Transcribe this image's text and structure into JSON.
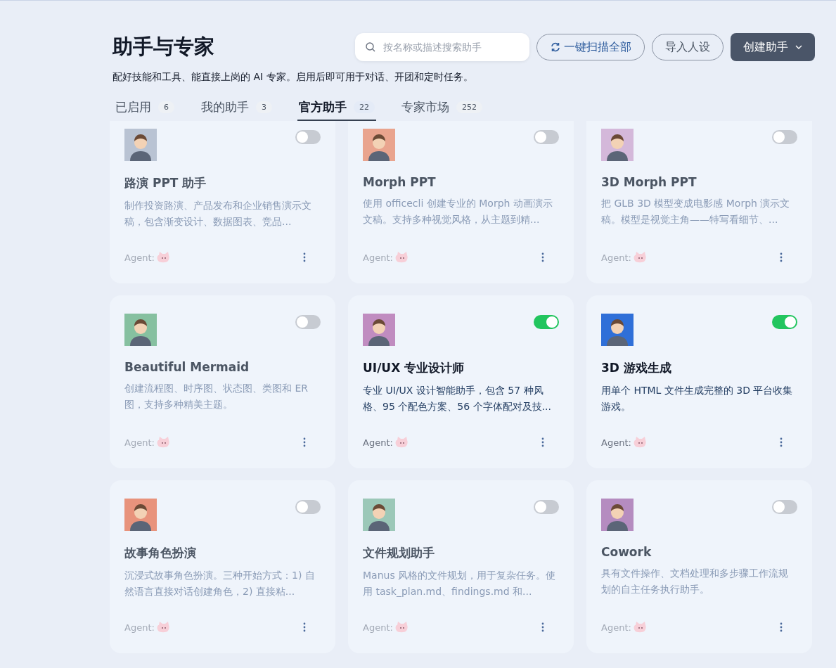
{
  "header": {
    "title": "助手与专家",
    "subtitle": "配好技能和工具、能直接上岗的 AI 专家。启用后即可用于对话、开团和定时任务。",
    "search": {
      "placeholder": "按名称或描述搜索助手"
    },
    "buttons": [
      {
        "label": "一键扫描全部",
        "kind": "scan"
      },
      {
        "label": "导入人设",
        "kind": "outline"
      },
      {
        "label": "创建助手",
        "kind": "primary"
      }
    ]
  },
  "tabs": [
    {
      "label": "已启用",
      "count": "6",
      "selected": false
    },
    {
      "label": "我的助手",
      "count": "3",
      "selected": false
    },
    {
      "label": "官方助手",
      "count": "22",
      "selected": true
    },
    {
      "label": "专家市场",
      "count": "252",
      "selected": false
    }
  ],
  "cards": [
    {
      "title": "路演 PPT 助手",
      "description": "制作投资路演、产品发布和企业销售演示文稿，包含渐变设计、数据图表、竞品...",
      "agent_label": "Agent:",
      "on": false,
      "color": "#b9c3d3"
    },
    {
      "title": "Morph PPT",
      "description": "使用 officecli 创建专业的 Morph 动画演示文稿。支持多种视觉风格，从主题到精...",
      "agent_label": "Agent:",
      "on": false,
      "color": "#e9a48e"
    },
    {
      "title": "3D Morph PPT",
      "description": "把 GLB 3D 模型变成电影感 Morph 演示文稿。模型是视觉主角——特写看细节、...",
      "agent_label": "Agent:",
      "on": false,
      "color": "#d4b8da"
    },
    {
      "title": "Beautiful Mermaid",
      "description": "创建流程图、时序图、状态图、类图和 ER 图，支持多种精美主题。",
      "agent_label": "Agent:",
      "on": false,
      "color": "#86c0a0"
    },
    {
      "title": "UI/UX 专业设计师",
      "description": "专业 UI/UX 设计智能助手，包含 57 种风格、95 个配色方案、56 个字体配对及技...",
      "agent_label": "Agent:",
      "on": true,
      "color": "#c08cc0"
    },
    {
      "title": "3D 游戏生成",
      "description": "用单个 HTML 文件生成完整的 3D 平台收集游戏。",
      "agent_label": "Agent:",
      "on": true,
      "color": "#2f6fd8"
    },
    {
      "title": "故事角色扮演",
      "description": "沉浸式故事角色扮演。三种开始方式：1) 自然语言直接对话创建角色，2) 直接粘...",
      "agent_label": "Agent:",
      "on": false,
      "color": "#e8937c"
    },
    {
      "title": "文件规划助手",
      "description": "Manus 风格的文件规划，用于复杂任务。使用 task_plan.md、findings.md 和...",
      "agent_label": "Agent:",
      "on": false,
      "color": "#9cc8b8"
    },
    {
      "title": "Cowork",
      "description": "具有文件操作、文档处理和多步骤工作流规划的自主任务执行助手。",
      "agent_label": "Agent:",
      "on": false,
      "color": "#b58cc0"
    }
  ]
}
